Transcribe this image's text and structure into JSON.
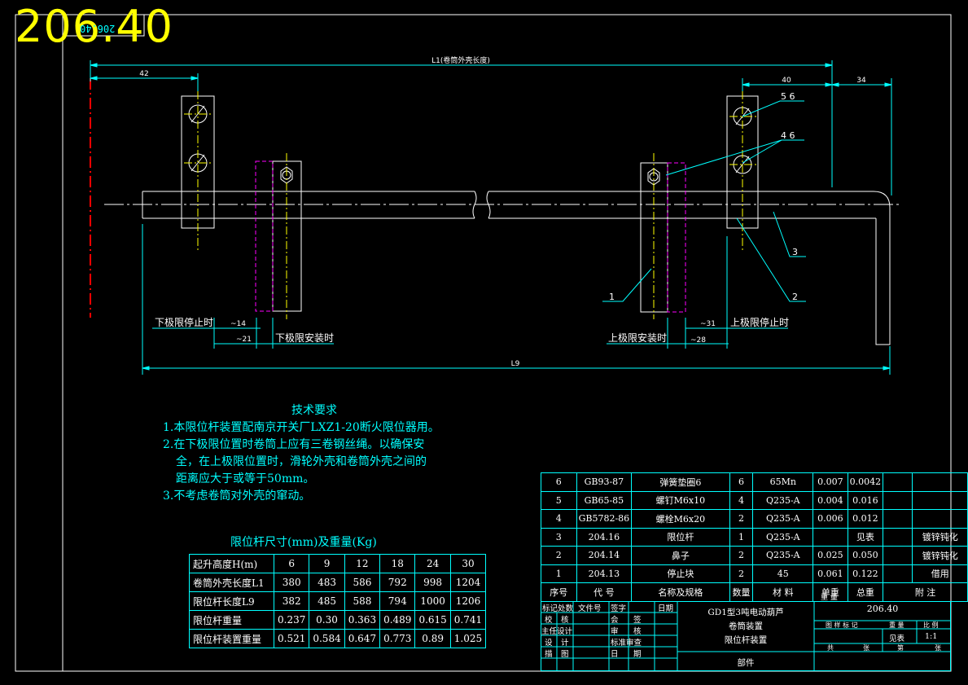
{
  "header": {
    "big_number": "206.40",
    "corner_code": "206.40"
  },
  "dimensions": {
    "l1": "L1(卷筒外壳长度)",
    "d42": "42",
    "d40": "40",
    "d34": "34",
    "d14": "~14",
    "d21a": "~21",
    "d21b": "~31",
    "d28": "~28",
    "l9": "L9"
  },
  "callouts": {
    "c56": "5  6",
    "c46": "4  6",
    "c1": "1",
    "c2": "2",
    "c3": "3"
  },
  "position_labels": {
    "lower_stop": "下极限停止时",
    "lower_install": "下极限安装时",
    "upper_install": "上极限安装时",
    "upper_stop": "上极限停止时"
  },
  "notes": {
    "title": "技术要求",
    "l1": "1.本限位杆装置配南京开关厂LXZ1-20断火限位器用。",
    "l2a": "2.在下极限位置时卷筒上应有三卷钢丝绳。以确保安",
    "l2b": "全，在上极限位置时，滑轮外壳和卷筒外壳之间的",
    "l2c": "距离应大于或等于50mm。",
    "l3": "3.不考虑卷筒对外壳的窜动。"
  },
  "size_table": {
    "title": "限位杆尺寸(mm)及重量(Kg)",
    "rows": [
      [
        "起升高度H(m)",
        "6",
        "9",
        "12",
        "18",
        "24",
        "30"
      ],
      [
        "卷筒外壳长度L1",
        "380",
        "483",
        "586",
        "792",
        "998",
        "1204"
      ],
      [
        "限位杆长度L9",
        "382",
        "485",
        "588",
        "794",
        "1000",
        "1206"
      ],
      [
        "限位杆重量",
        "0.237",
        "0.30",
        "0.363",
        "0.489",
        "0.615",
        "0.741"
      ],
      [
        "限位杆装置重量",
        "0.521",
        "0.584",
        "0.647",
        "0.773",
        "0.89",
        "1.025"
      ]
    ]
  },
  "parts": {
    "rows": [
      [
        "6",
        "GB93-87",
        "弹簧垫圈6",
        "6",
        "65Mn",
        "0.007",
        "0.0042",
        "",
        ""
      ],
      [
        "5",
        "GB65-85",
        "螺钉M6x10",
        "4",
        "Q235-A",
        "0.004",
        "0.016",
        "",
        ""
      ],
      [
        "4",
        "GB5782-86",
        "螺栓M6x20",
        "2",
        "Q235-A",
        "0.006",
        "0.012",
        "",
        ""
      ],
      [
        "3",
        "204.16",
        "限位杆",
        "1",
        "Q235-A",
        "",
        "见表",
        "",
        "镀锌钝化"
      ],
      [
        "2",
        "204.14",
        "鼻子",
        "2",
        "Q235-A",
        "0.025",
        "0.050",
        "",
        "镀锌钝化"
      ],
      [
        "1",
        "204.13",
        "停止块",
        "2",
        "45",
        "0.061",
        "0.122",
        "",
        "借用"
      ]
    ],
    "header": [
      "序号",
      "代  号",
      "名称及规格",
      "数量",
      "材   料",
      "单重",
      "总重",
      "附   注"
    ],
    "weight_header": "重  量"
  },
  "title_block": {
    "left_rows": [
      [
        "标记",
        "处数",
        "文件号",
        "签字",
        "日期"
      ],
      [
        "校",
        "核",
        "",
        "会",
        "签"
      ],
      [
        "主任设计",
        "",
        "",
        "审",
        "核"
      ],
      [
        "设",
        "计",
        "",
        "标准审查",
        ""
      ],
      [
        "描",
        "图",
        "",
        "日",
        "期"
      ]
    ],
    "product_line1": "GD1型3吨电动葫芦",
    "product_line2": "卷筒装置",
    "product_line3": "限位杆装置",
    "category": "部件",
    "drawing_no": "206.40",
    "stage_header": "图  样  标  记",
    "weight_header": "重  量",
    "scale_header": "比  例",
    "weight_value": "见表",
    "scale_value": "1:1",
    "sheet_total": "共",
    "sheet_label": "张",
    "sheet_num": "第",
    "sheet_label2": "张"
  },
  "colors": {
    "background": "#000000",
    "line": "#ffffff",
    "dimension": "#00ffff",
    "centerline": "#ffff00",
    "hidden": "#ff00ff",
    "red_centerline": "#ff0000"
  }
}
